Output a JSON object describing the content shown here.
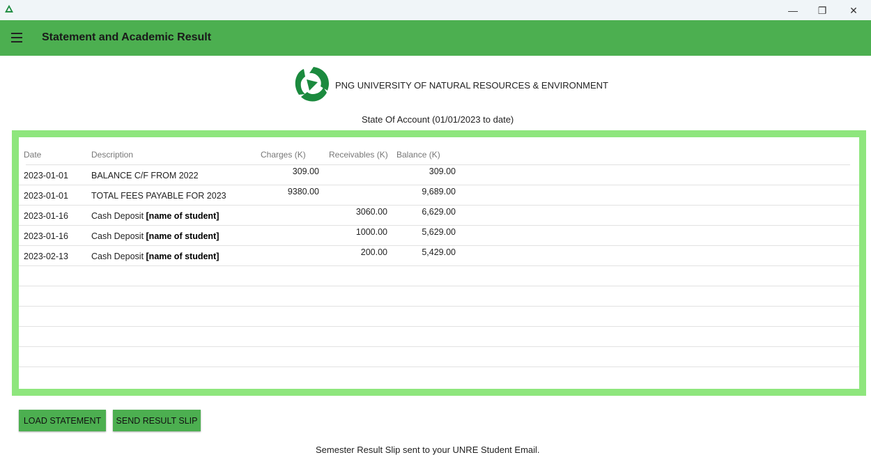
{
  "window": {
    "minimize_glyph": "—",
    "maximize_glyph": "❐",
    "close_glyph": "✕",
    "app_icon": "unre-logo-icon"
  },
  "appbar": {
    "title": "Statement and Academic Result",
    "menu_icon": "hamburger-icon",
    "color": "#4caf50"
  },
  "header": {
    "university_name": "PNG UNIVERSITY OF NATURAL RESOURCES & ENVIRONMENT",
    "statement_title": "State Of Account (01/01/2023 to date)",
    "logo_color": "#1b8a3e"
  },
  "table": {
    "frame_color": "#8ee67d",
    "columns": [
      "Date",
      "Description",
      "Charges (K)",
      "Receivables (K)",
      "Balance (K)"
    ],
    "rows": [
      {
        "date": "2023-01-01",
        "description": "BALANCE C/F FROM 2022",
        "redacted": "",
        "charges": "309.00",
        "receivables": "",
        "balance": "309.00"
      },
      {
        "date": "2023-01-01",
        "description": "TOTAL FEES PAYABLE FOR 2023",
        "redacted": "",
        "charges": "9380.00",
        "receivables": "",
        "balance": "9,689.00"
      },
      {
        "date": "2023-01-16",
        "description": "Cash Deposit ",
        "redacted": "[name of student]",
        "charges": "",
        "receivables": "3060.00",
        "balance": "6,629.00"
      },
      {
        "date": "2023-01-16",
        "description": "Cash Deposit ",
        "redacted": "[name of student]",
        "charges": "",
        "receivables": "1000.00",
        "balance": "5,629.00"
      },
      {
        "date": "2023-02-13",
        "description": "Cash Deposit ",
        "redacted": "[name of student]",
        "charges": "",
        "receivables": "200.00",
        "balance": "5,429.00"
      }
    ]
  },
  "actions": {
    "load_label": "LOAD STATEMENT",
    "send_label": "SEND RESULT SLIP"
  },
  "status": {
    "message": "Semester Result Slip sent to your UNRE Student Email."
  }
}
